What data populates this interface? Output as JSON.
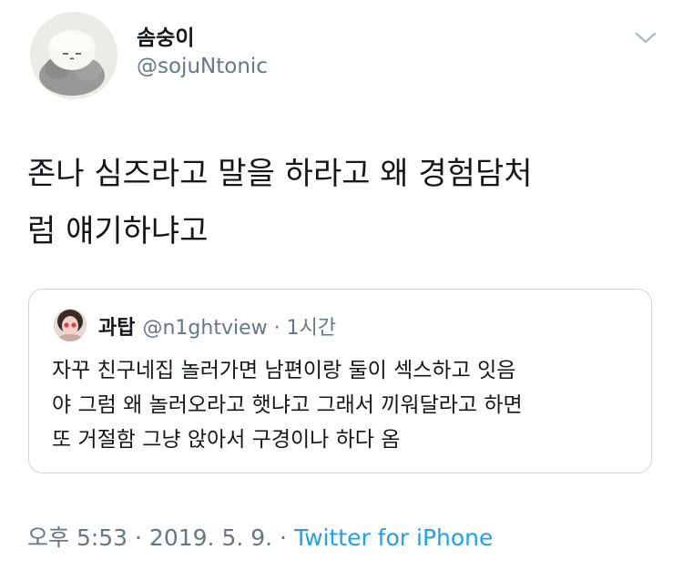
{
  "author": {
    "display_name": "솜숭이",
    "handle": "@sojuNtonic",
    "avatar_icon": "plush-toy-avatar"
  },
  "menu_icon": "chevron-down-icon",
  "tweet": {
    "lines": [
      "존나 심즈라고 말을 하라고 왜 경험담처",
      "럼 얘기하냐고"
    ]
  },
  "quote": {
    "display_name": "과탑",
    "handle": "@n1ghtview",
    "time": " · 1시간",
    "avatar_icon": "person-photo-avatar",
    "lines": [
      "자꾸 친구네집 놀러가면 남편이랑 둘이 섹스하고 잇음",
      "야 그럼 왜 놀러오라고 햇냐고 그래서 끼워달라고 하면",
      "또 거절함 그냥 앉아서 구경이나 하다 옴"
    ]
  },
  "meta": {
    "timestamp": "오후 5:53 · 2019. 5. 9. · ",
    "source": "Twitter for iPhone"
  },
  "colors": {
    "text": "#14171a",
    "secondary": "#657786",
    "link": "#1da1f2",
    "border": "#ccd6dd"
  }
}
